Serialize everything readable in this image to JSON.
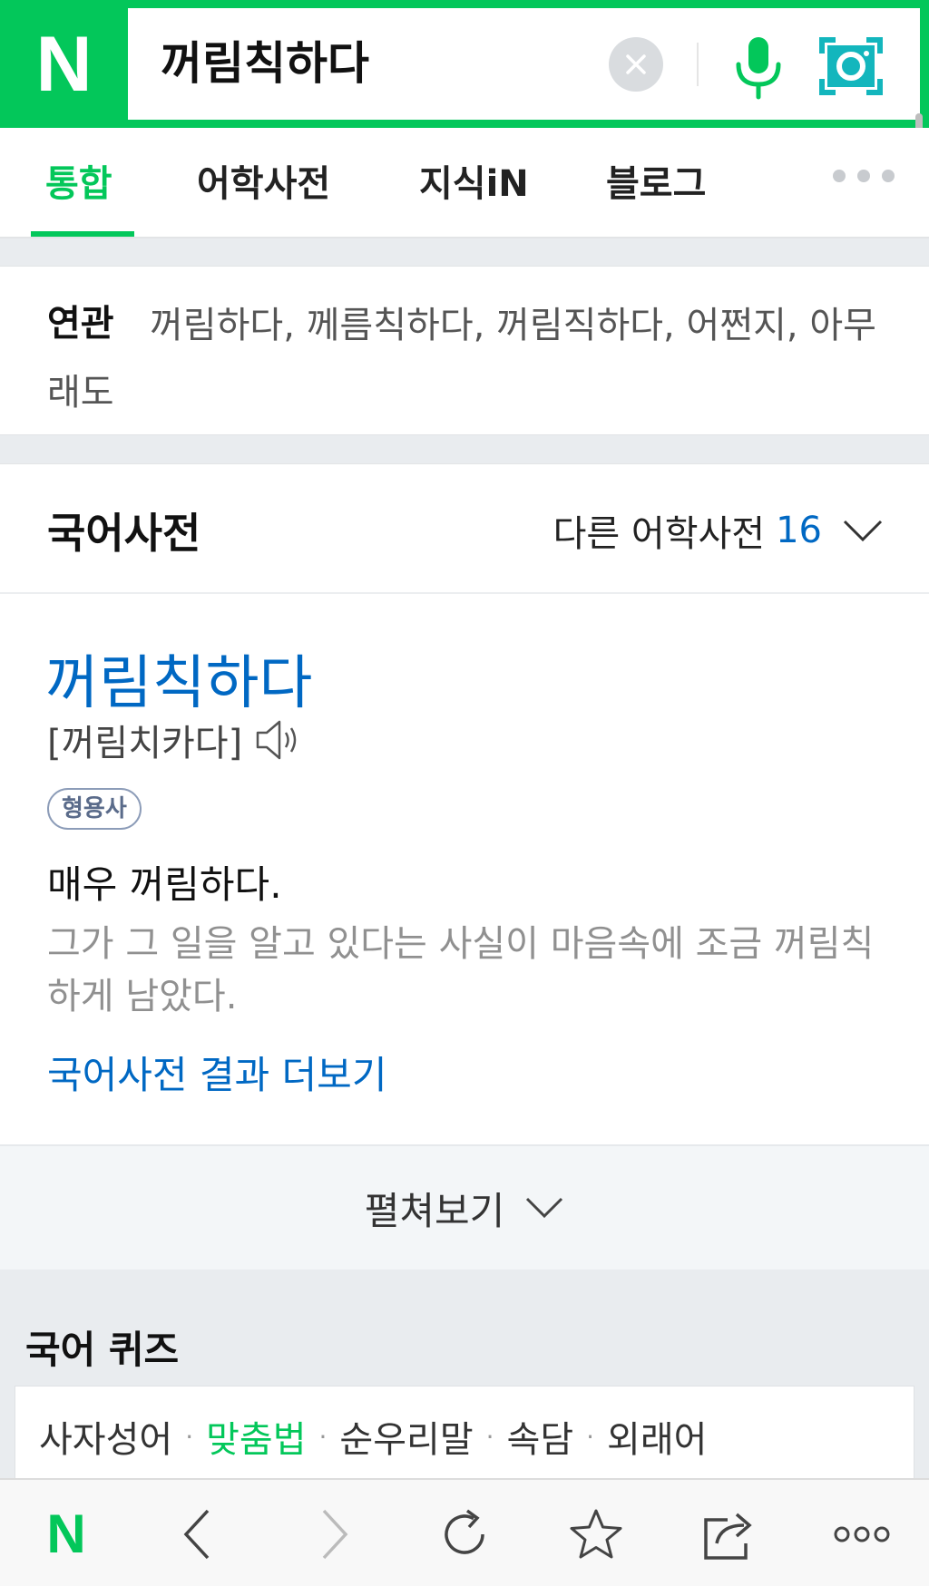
{
  "header": {
    "logo": "N",
    "search_query": "꺼림칙하다"
  },
  "tabs": [
    {
      "label": "통합",
      "active": true
    },
    {
      "label": "어학사전",
      "active": false
    },
    {
      "label": "지식iN",
      "active": false
    },
    {
      "label": "블로그",
      "active": false
    }
  ],
  "related": {
    "label": "연관",
    "terms": "꺼림하다, 께름칙하다, 꺼림직하다, 어쩐지, 아무래도"
  },
  "dictionary": {
    "section_title": "국어사전",
    "other_dicts_label": "다른 어학사전",
    "other_dicts_count": "16",
    "word": "꺼림칙하다",
    "pronunciation": "[꺼림치카다]",
    "part_of_speech": "형용사",
    "meaning": "매우 꺼림하다.",
    "example": "그가 그 일을 알고 있다는 사실이 마음속에 조금 꺼림칙하게 남았다.",
    "more_link": "국어사전 결과 더보기",
    "expand_label": "펼쳐보기"
  },
  "quiz": {
    "title": "국어 퀴즈",
    "categories": [
      "사자성어",
      "맞춤법",
      "순우리말",
      "속담",
      "외래어"
    ],
    "active_index": 1
  },
  "bottom_bar": {
    "logo": "N"
  },
  "colors": {
    "brand_green": "#03c75a",
    "link_blue": "#0068c3"
  }
}
